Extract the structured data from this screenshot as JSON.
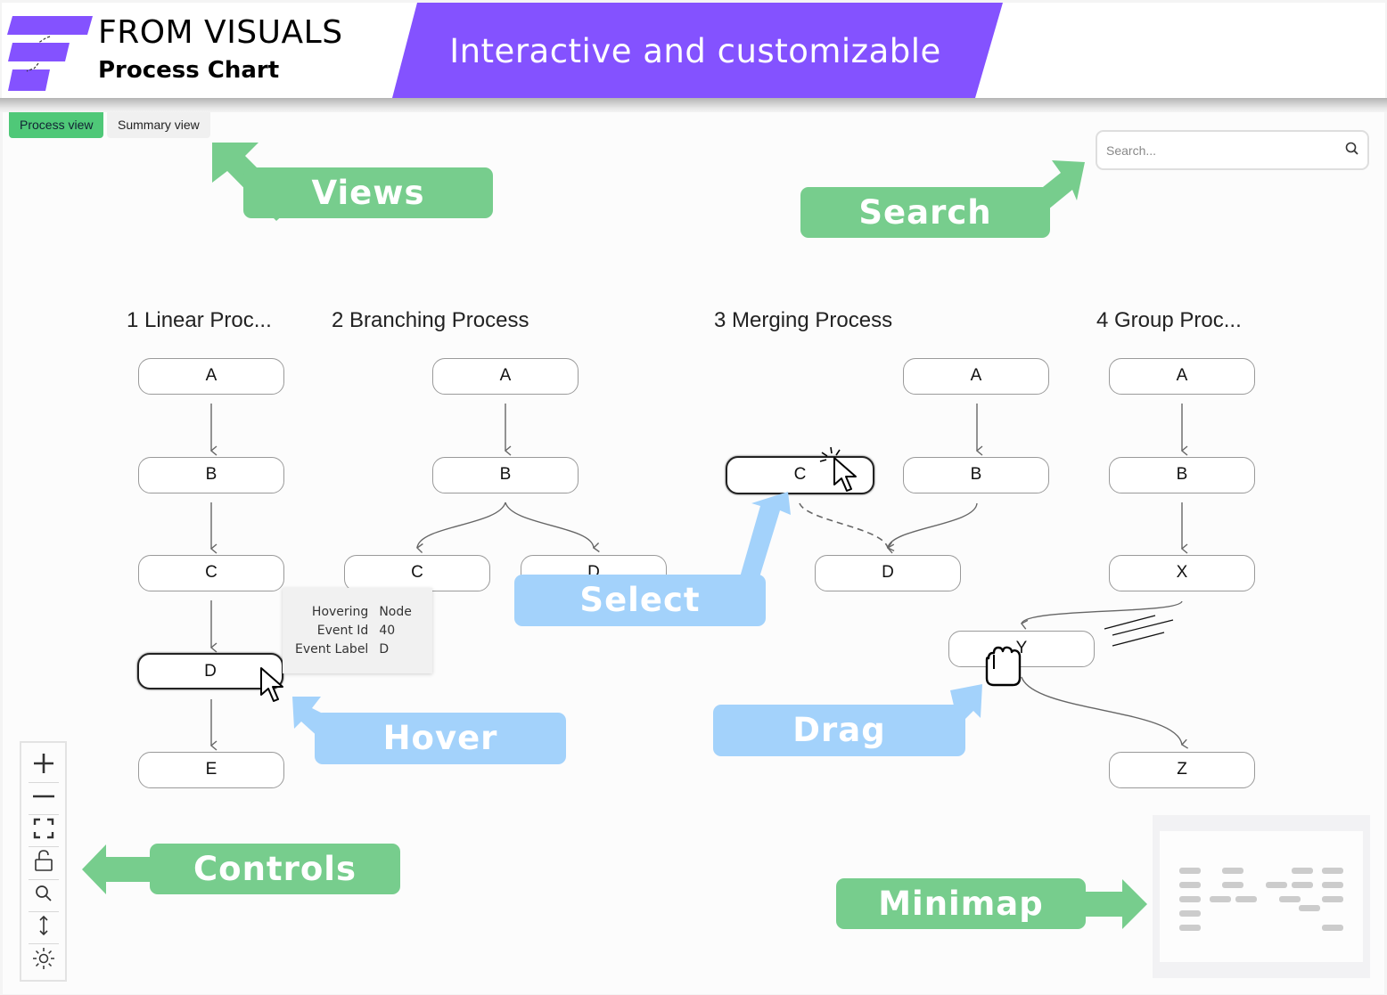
{
  "header": {
    "brand": "FROM VISUALS",
    "product": "Process Chart",
    "tagline": "Interactive and customizable",
    "colors": {
      "accent": "#8452ff",
      "green": "#77cd8d",
      "blue": "#a3d2fb",
      "tab_active": "#4fc878"
    }
  },
  "tabs": [
    {
      "label": "Process view",
      "active": true
    },
    {
      "label": "Summary view",
      "active": false
    }
  ],
  "search": {
    "placeholder": "Search...",
    "value": "",
    "icon": "search-icon"
  },
  "processes": [
    {
      "title": "1 Linear Proc...",
      "nodes": [
        "A",
        "B",
        "C",
        "D",
        "E"
      ]
    },
    {
      "title": "2 Branching Process",
      "nodes": [
        "A",
        "B",
        "C",
        "D"
      ]
    },
    {
      "title": "3 Merging Process",
      "nodes": [
        "C",
        "A",
        "B",
        "D"
      ]
    },
    {
      "title": "4 Group Proc...",
      "nodes": [
        "A",
        "B",
        "X",
        "Y",
        "Z"
      ]
    }
  ],
  "tooltip": {
    "rows": [
      {
        "key": "Hovering",
        "value": "Node"
      },
      {
        "key": "Event Id",
        "value": "40"
      },
      {
        "key": "Event Label",
        "value": "D"
      }
    ]
  },
  "callouts": {
    "views": "Views",
    "search": "Search",
    "select": "Select",
    "hover": "Hover",
    "drag": "Drag",
    "controls": "Controls",
    "minimap": "Minimap"
  },
  "controls": [
    {
      "name": "zoom-in",
      "icon": "plus-icon"
    },
    {
      "name": "zoom-out",
      "icon": "minus-icon"
    },
    {
      "name": "fit-view",
      "icon": "fit-screen-icon"
    },
    {
      "name": "lock",
      "icon": "unlock-icon"
    },
    {
      "name": "search",
      "icon": "search-icon"
    },
    {
      "name": "orientation",
      "icon": "vertical-arrows-icon"
    },
    {
      "name": "theme",
      "icon": "sun-icon"
    }
  ]
}
